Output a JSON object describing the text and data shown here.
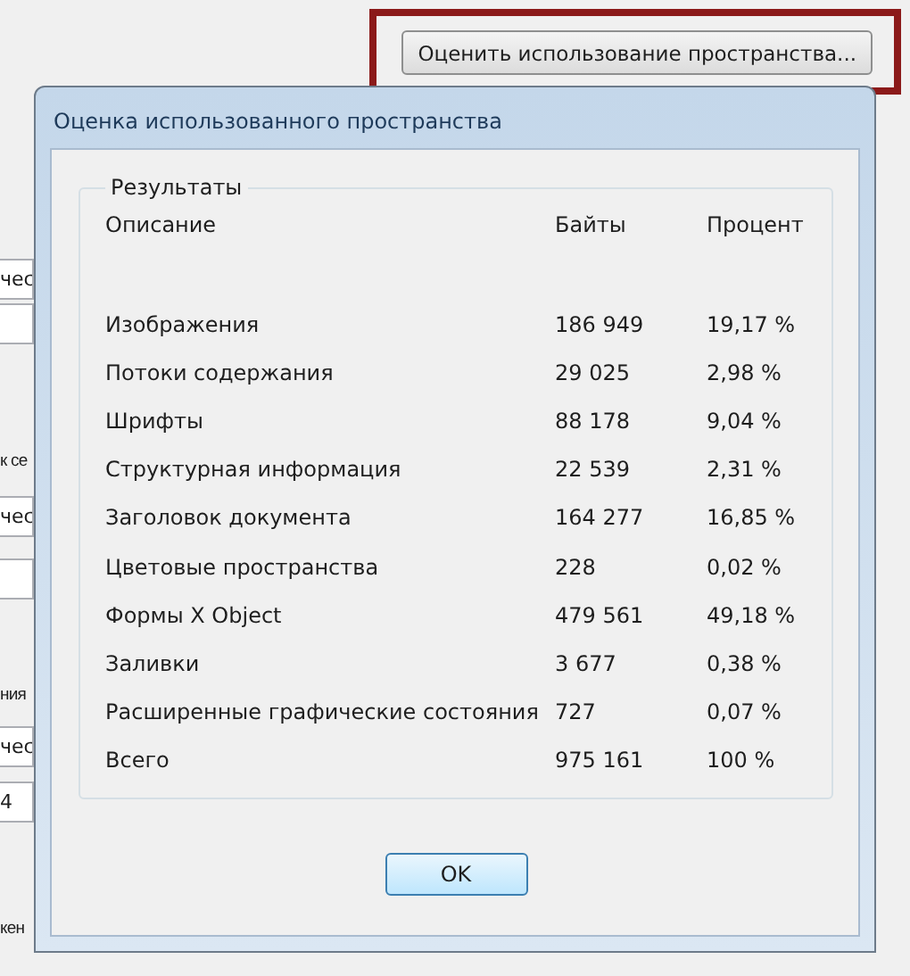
{
  "background_window": {
    "estimate_button": "Оценить использование пространства...",
    "highlighted": true,
    "left_edge": [
      {
        "kind": "field",
        "text": "чес"
      },
      {
        "kind": "field"
      },
      {
        "kind": "label",
        "text": "к се"
      },
      {
        "kind": "field",
        "text": "чес"
      },
      {
        "kind": "field"
      },
      {
        "kind": "label",
        "text": "ния"
      },
      {
        "kind": "field",
        "text": "чес"
      },
      {
        "kind": "field",
        "text": "4"
      },
      {
        "kind": "label",
        "text": "кен"
      }
    ]
  },
  "dialog": {
    "title": "Оценка использованного пространства",
    "group_title": "Результаты",
    "columns": [
      "Описание",
      "Байты",
      "Процент"
    ],
    "rows": [
      [
        "Изображения",
        "186 949",
        "19,17 %"
      ],
      [
        "Потоки содержания",
        "29 025",
        "2,98 %"
      ],
      [
        "Шрифты",
        "88 178",
        "9,04 %"
      ],
      [
        "Структурная информация",
        "22 539",
        "2,31 %"
      ],
      [
        "Заголовок документа",
        "164 277",
        "16,85 %"
      ],
      [
        "Цветовые пространства",
        "228",
        "0,02 %"
      ],
      [
        "Формы X Object",
        "479 561",
        "49,18 %"
      ],
      [
        "Заливки",
        "3 677",
        "0,38 %"
      ],
      [
        "Расширенные графические состояния",
        "727",
        "0,07 %"
      ],
      [
        "Всего",
        "975 161",
        "100 %"
      ]
    ],
    "ok_button": "OK"
  }
}
